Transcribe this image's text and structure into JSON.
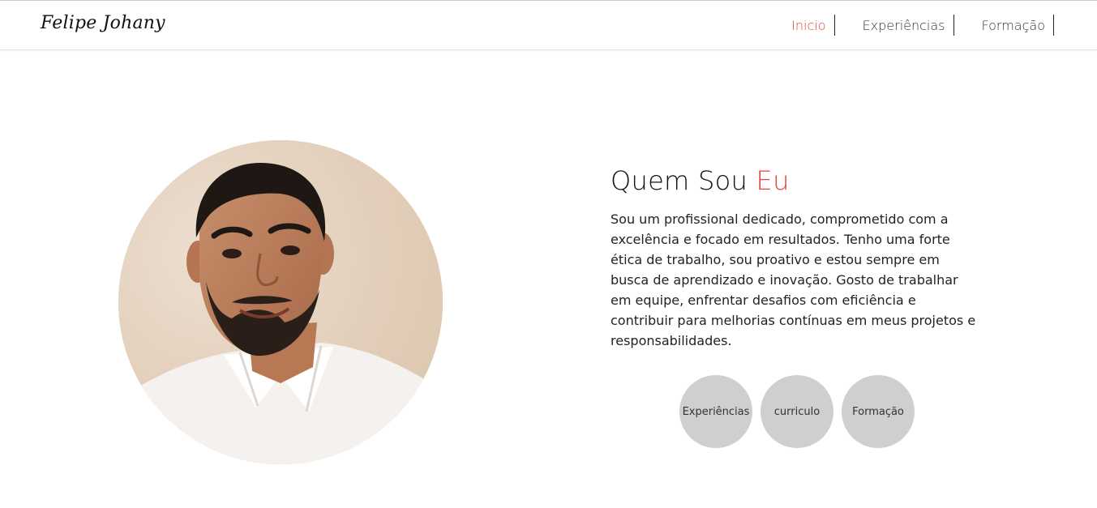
{
  "header": {
    "logo": "Felipe Johany",
    "nav": [
      {
        "label": "Inicio",
        "active": true
      },
      {
        "label": "Experiências",
        "active": false
      },
      {
        "label": "Formação",
        "active": false
      }
    ]
  },
  "about": {
    "title_main": "Quem Sou ",
    "title_accent": "Eu",
    "paragraph": "Sou um profissional dedicado, comprometido com a excelência e focado em resultados. Tenho uma forte ética de trabalho, sou proativo e estou sempre em busca de aprendizado e inovação. Gosto de trabalhar em equipe, enfrentar desafios com eficiência e contribuir para melhorias contínuas em meus projetos e responsabilidades."
  },
  "buttons": [
    {
      "label": "Experiências"
    },
    {
      "label": "curriculo"
    },
    {
      "label": "Formação"
    }
  ],
  "colors": {
    "accent": "#e8413c",
    "circle_button": "#cfcfcf"
  }
}
